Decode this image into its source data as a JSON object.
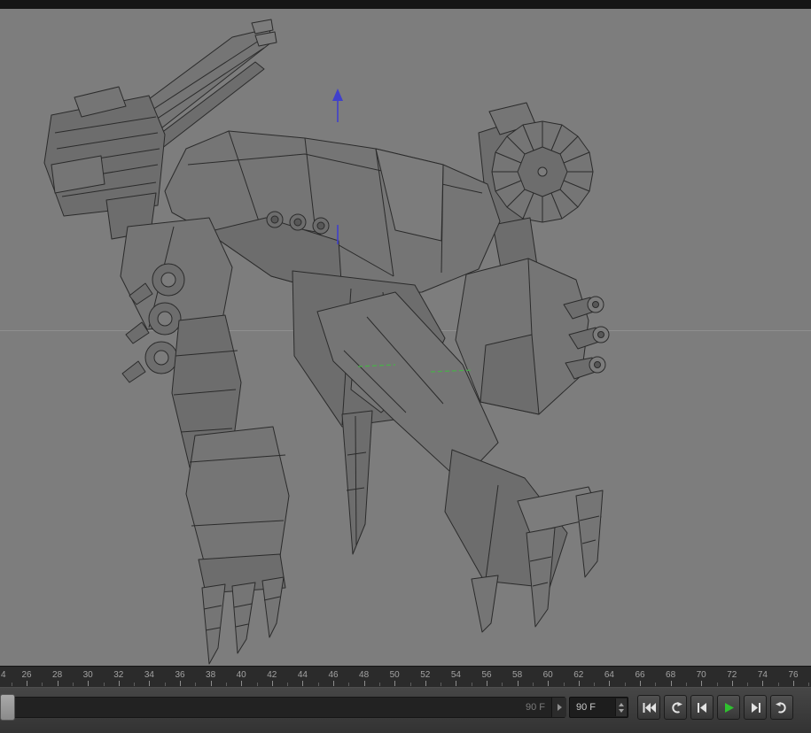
{
  "top_bar": {
    "background": "#151515"
  },
  "viewport": {
    "background": "#7d7d7d",
    "axis_line_color": "#8f8f8f",
    "model": {
      "name": "wireframe-mech",
      "surface_color": "#757575",
      "surface_color_dark": "#6d6d6d",
      "surface_color_light": "#7c7c7c",
      "wire_color": "#2b2b2b"
    },
    "gizmo": {
      "y_axis_color": "#4040cc",
      "snap_guide_color": "#49b049"
    }
  },
  "timeline_ruler": {
    "background": "#2b2b2b",
    "label_color": "#a2a2a2",
    "start_label": "4",
    "frame_labels": [
      26,
      28,
      30,
      32,
      34,
      36,
      38,
      40,
      42,
      44,
      46,
      48,
      50,
      52,
      54,
      56,
      58,
      60,
      62,
      64,
      66,
      68,
      70,
      72,
      74,
      76
    ]
  },
  "playback_bar": {
    "range_slider_value": "90 F",
    "frame_field_value": "90 F"
  },
  "transport_controls": {
    "play_icon_color": "#2fc12f",
    "buttons": [
      {
        "name": "go-to-start",
        "icon": "skip-to-start-icon"
      },
      {
        "name": "go-to-previous-key",
        "icon": "loop-left-icon"
      },
      {
        "name": "go-to-previous-frame",
        "icon": "step-back-icon"
      },
      {
        "name": "play-forwards",
        "icon": "play-icon"
      },
      {
        "name": "go-to-next-frame",
        "icon": "step-forward-icon"
      },
      {
        "name": "go-to-next-key",
        "icon": "loop-right-icon"
      }
    ]
  }
}
